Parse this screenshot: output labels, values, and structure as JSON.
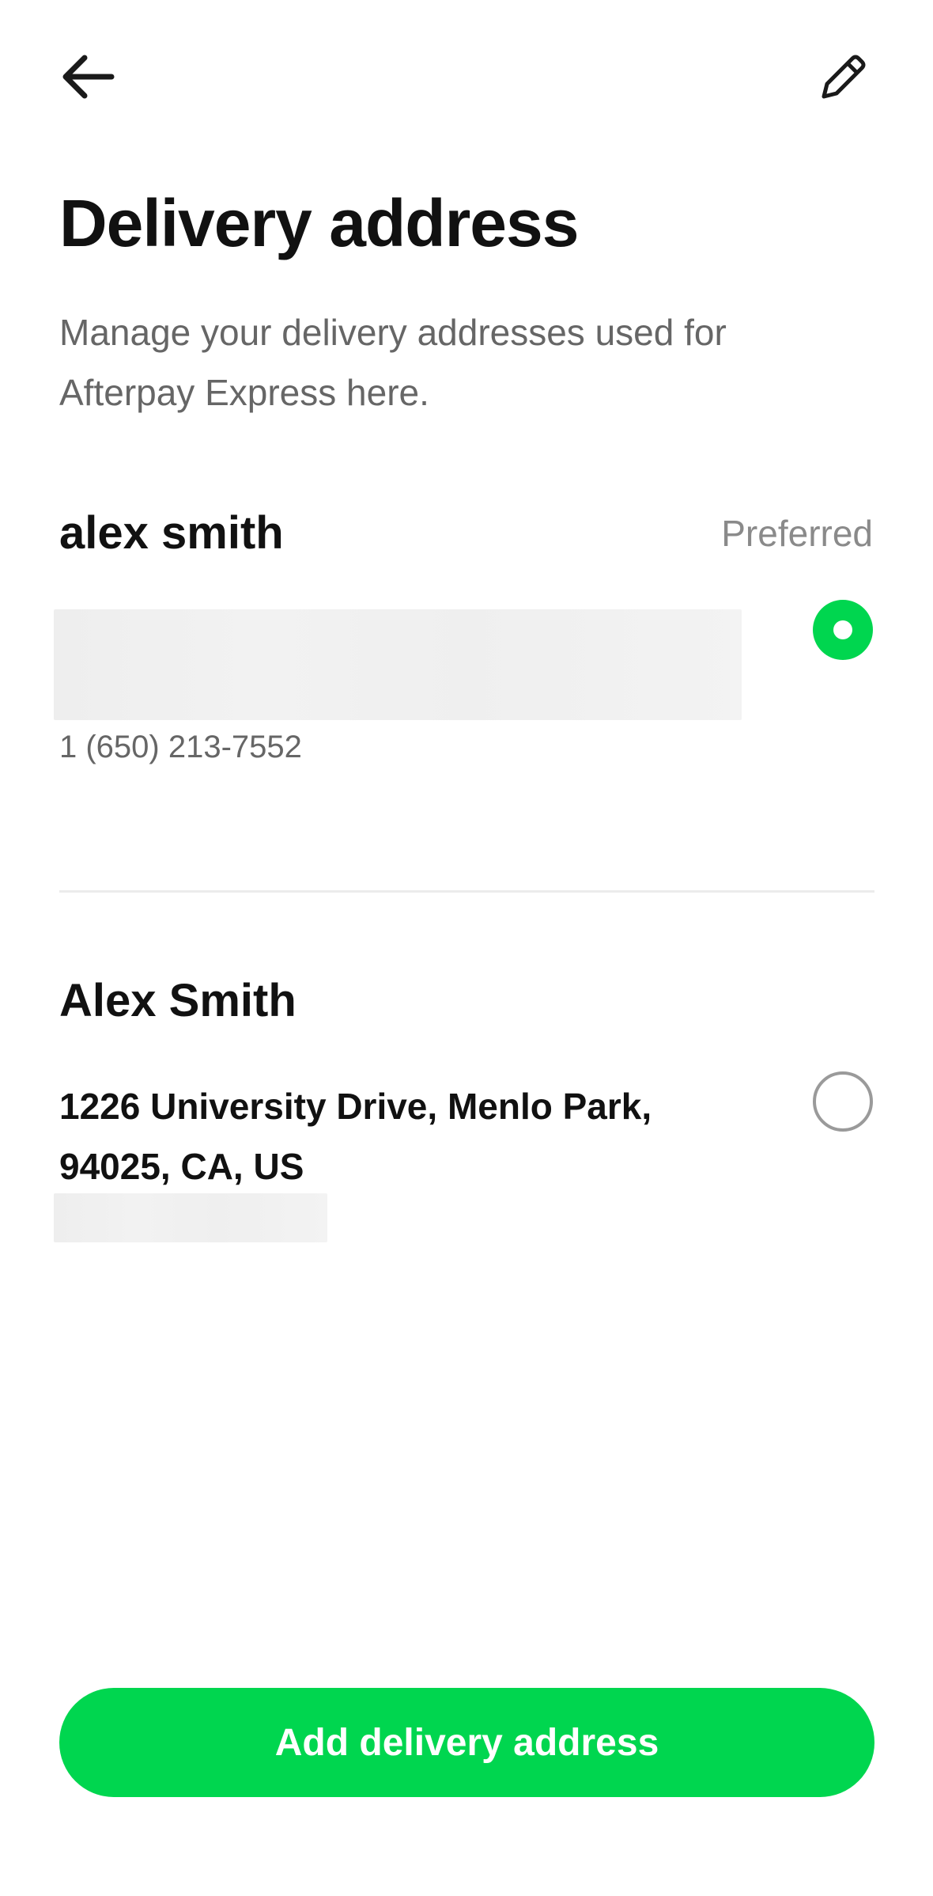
{
  "header": {
    "back_icon": "arrow-left-icon",
    "edit_icon": "pencil-icon"
  },
  "page": {
    "title": "Delivery address",
    "subtitle": "Manage your delivery addresses used for Afterpay Express here."
  },
  "addresses": [
    {
      "name": "alex smith",
      "badge": "Preferred",
      "phone": "1 (650) 213-7552",
      "selected": true
    },
    {
      "name": "Alex Smith",
      "address": "1226 University Drive, Menlo Park, 94025, CA, US",
      "selected": false
    }
  ],
  "actions": {
    "add_label": "Add delivery address"
  },
  "colors": {
    "accent": "#00d64f",
    "text_primary": "#111111",
    "text_secondary": "#666666",
    "text_muted": "#8a8a8a",
    "divider": "#ececec"
  }
}
